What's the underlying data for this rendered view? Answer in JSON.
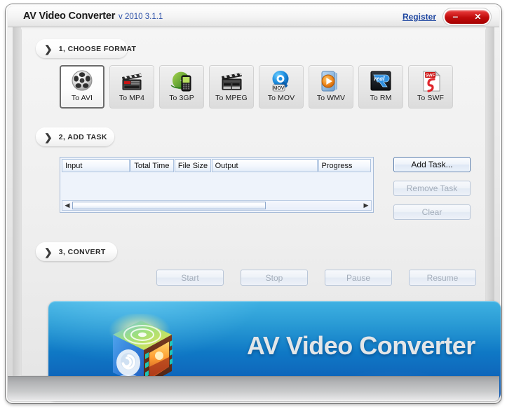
{
  "window": {
    "title": "AV Video Converter",
    "version": "v 2010  3.1.1",
    "register_label": "Register",
    "minimize_glyph": "–",
    "close_glyph": "✕"
  },
  "steps": {
    "choose_format": {
      "chevron": "❯",
      "label": "1, CHOOSE FORMAT"
    },
    "add_task": {
      "chevron": "❯",
      "label": "2, ADD TASK"
    },
    "convert": {
      "chevron": "❯",
      "label": "3, CONVERT"
    }
  },
  "formats": [
    {
      "label": "To AVI",
      "icon": "film-reel-icon",
      "selected": true
    },
    {
      "label": "To MP4",
      "icon": "clapperboard-icon",
      "selected": false
    },
    {
      "label": "To 3GP",
      "icon": "mobile-phone-icon",
      "selected": false
    },
    {
      "label": "To MPEG",
      "icon": "film-slate-icon",
      "selected": false
    },
    {
      "label": "To MOV",
      "icon": "quicktime-icon",
      "selected": false
    },
    {
      "label": "To WMV",
      "icon": "media-player-icon",
      "selected": false
    },
    {
      "label": "To RM",
      "icon": "realplayer-icon",
      "selected": false
    },
    {
      "label": "To SWF",
      "icon": "flash-file-icon",
      "selected": false
    }
  ],
  "task_table": {
    "columns": [
      {
        "label": "Input",
        "width": 98
      },
      {
        "label": "Total Time",
        "width": 62
      },
      {
        "label": "File Size",
        "width": 52
      },
      {
        "label": "Output",
        "width": 152
      },
      {
        "label": "Progress",
        "width": 76
      }
    ],
    "rows": [],
    "scrollbar": {
      "left_arrow": "◀",
      "right_arrow": "▶",
      "thumb_percent": 67
    }
  },
  "side_buttons": [
    {
      "label": "Add Task...",
      "enabled": true
    },
    {
      "label": "Remove Task",
      "enabled": false
    },
    {
      "label": "Clear",
      "enabled": false
    }
  ],
  "convert_buttons": [
    {
      "label": "Start",
      "enabled": false
    },
    {
      "label": "Stop",
      "enabled": false
    },
    {
      "label": "Pause",
      "enabled": false
    },
    {
      "label": "Resume",
      "enabled": false
    }
  ],
  "banner": {
    "title": "AV Video Converter",
    "logo": "av-video-converter-cube-logo"
  },
  "colors": {
    "banner_top": "#0f9ddb",
    "banner_bottom": "#1152a8",
    "link": "#1e46a0",
    "close_button": "#c00c0c",
    "version_text": "#2c50a8",
    "banner_title": "#e3e6e8"
  }
}
